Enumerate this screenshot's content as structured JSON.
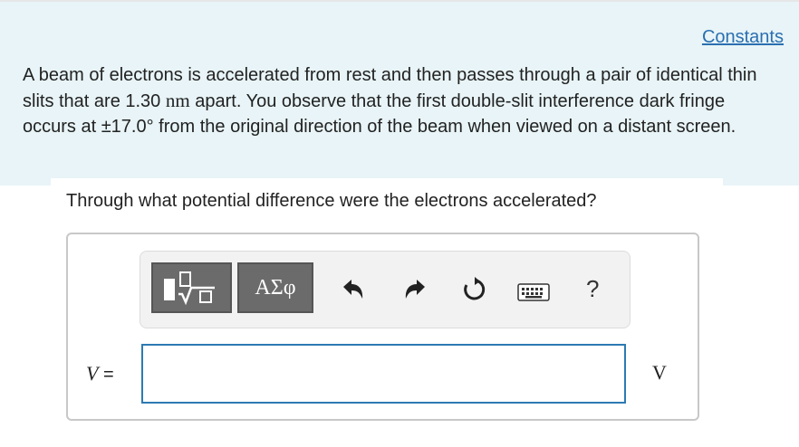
{
  "problem": {
    "constants_link": "Constants",
    "text_before": "A beam of electrons is accelerated from rest and then passes through a pair of identical thin slits that are 1.30 ",
    "slit_unit": "nm",
    "text_middle": " apart. You observe that the first double-slit interference dark fringe occurs at ",
    "angle": "±17.0°",
    "text_after": " from the original direction of the beam when viewed on a distant screen."
  },
  "question": {
    "text": "Through what potential difference were the electrons accelerated?"
  },
  "toolbar": {
    "greek_label": "ΑΣφ",
    "help_label": "?",
    "icons": [
      "templates-icon",
      "undo-icon",
      "redo-icon",
      "reset-icon",
      "keyboard-icon",
      "help-icon"
    ]
  },
  "answer": {
    "variable": "V",
    "equals": " =",
    "value": "",
    "placeholder": "",
    "unit": "V"
  },
  "colors": {
    "problem_background": "#e8f4f7",
    "link": "#2a6fb0",
    "input_border": "#2d7ab3",
    "toolbar_button": "#6b6b6b"
  }
}
